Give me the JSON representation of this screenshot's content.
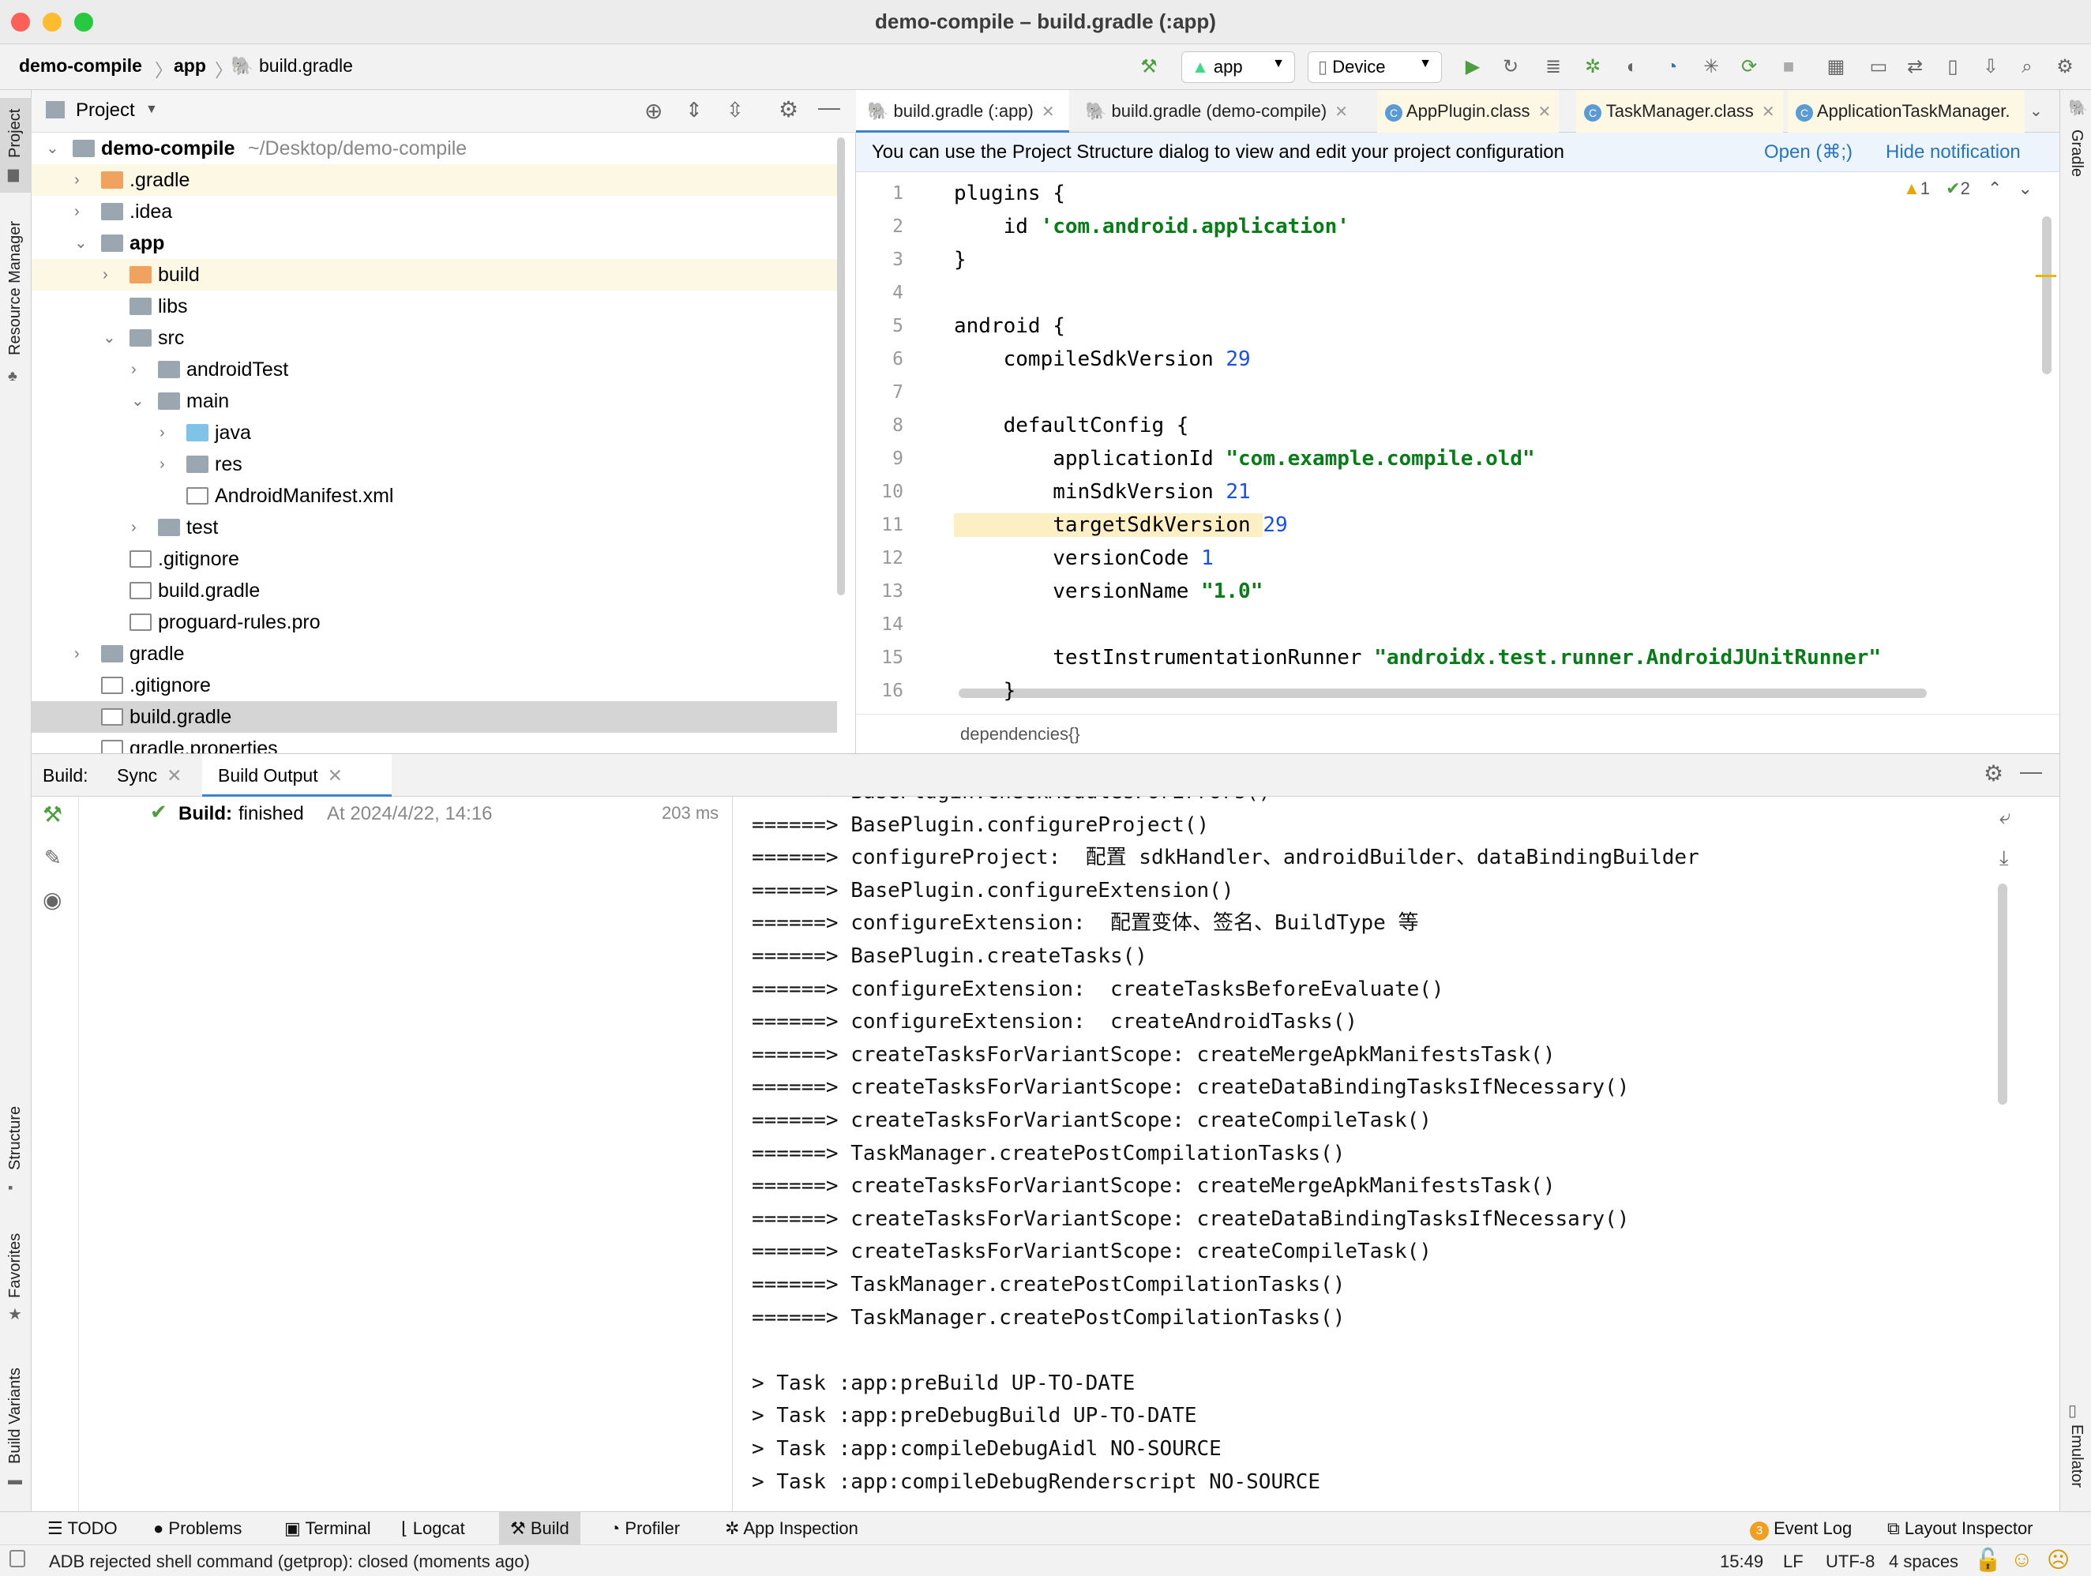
{
  "window": {
    "title": "demo-compile – build.gradle (:app)"
  },
  "breadcrumb": {
    "project": "demo-compile",
    "module": "app",
    "file": "build.gradle"
  },
  "toolbar": {
    "config": "app",
    "device": "Device"
  },
  "left_strip": {
    "project": "Project",
    "resource_manager": "Resource Manager",
    "structure": "Structure",
    "favorites": "Favorites",
    "build_variants": "Build Variants"
  },
  "right_strip": {
    "gradle": "Gradle",
    "emulator": "Emulator"
  },
  "project_panel": {
    "title": "Project",
    "tree": [
      {
        "name": "demo-compile",
        "path": "~/Desktop/demo-compile"
      },
      {
        "name": ".gradle"
      },
      {
        "name": ".idea"
      },
      {
        "name": "app"
      },
      {
        "name": "build"
      },
      {
        "name": "libs"
      },
      {
        "name": "src"
      },
      {
        "name": "androidTest"
      },
      {
        "name": "main"
      },
      {
        "name": "java"
      },
      {
        "name": "res"
      },
      {
        "name": "AndroidManifest.xml"
      },
      {
        "name": "test"
      },
      {
        "name": ".gitignore"
      },
      {
        "name": "build.gradle"
      },
      {
        "name": "proguard-rules.pro"
      },
      {
        "name": "gradle"
      },
      {
        "name": ".gitignore"
      },
      {
        "name": "build.gradle"
      },
      {
        "name": "gradle.properties"
      }
    ]
  },
  "editor": {
    "tabs": [
      "build.gradle (:app)",
      "build.gradle (demo-compile)",
      "AppPlugin.class",
      "TaskManager.class",
      "ApplicationTaskManager."
    ],
    "notification": {
      "text": "You can use the Project Structure dialog to view and edit your project configuration",
      "open": "Open (⌘;)",
      "hide": "Hide notification"
    },
    "inspections": {
      "warnings": "1",
      "checks": "2"
    },
    "lines": [
      {
        "n": "1",
        "text": "plugins {"
      },
      {
        "n": "2",
        "a": "    id ",
        "b": "'com.android.application'"
      },
      {
        "n": "3",
        "text": "}"
      },
      {
        "n": "4",
        "text": ""
      },
      {
        "n": "5",
        "text": "android {"
      },
      {
        "n": "6",
        "a": "    compileSdkVersion ",
        "c": "29"
      },
      {
        "n": "7",
        "text": ""
      },
      {
        "n": "8",
        "text": "    defaultConfig {"
      },
      {
        "n": "9",
        "a": "        applicationId ",
        "b": "\"com.example.compile.old\""
      },
      {
        "n": "10",
        "a": "        minSdkVersion ",
        "c": "21"
      },
      {
        "n": "11",
        "a": "        targetSdkVersion ",
        "c": "29"
      },
      {
        "n": "12",
        "a": "        versionCode ",
        "c": "1"
      },
      {
        "n": "13",
        "a": "        versionName ",
        "b": "\"1.0\""
      },
      {
        "n": "14",
        "text": ""
      },
      {
        "n": "15",
        "a": "        testInstrumentationRunner ",
        "b": "\"androidx.test.runner.AndroidJUnitRunner\""
      },
      {
        "n": "16",
        "text": "    }"
      }
    ],
    "crumb": "dependencies{}"
  },
  "build": {
    "label": "Build:",
    "tabs": [
      "Sync",
      "Build Output"
    ],
    "status": {
      "bold": "Build:",
      "text": "finished",
      "time": "At 2024/4/22, 14:16",
      "duration": "203 ms"
    },
    "output": [
      "======> BasePlugin.checkModulesForErrors()",
      "======> BasePlugin.configureProject()",
      "======> configureProject:  配置 sdkHandler、androidBuilder、dataBindingBuilder",
      "======> BasePlugin.configureExtension()",
      "======> configureExtension:  配置变体、签名、BuildType 等",
      "======> BasePlugin.createTasks()",
      "======> configureExtension:  createTasksBeforeEvaluate()",
      "======> configureExtension:  createAndroidTasks()",
      "======> createTasksForVariantScope: createMergeApkManifestsTask()",
      "======> createTasksForVariantScope: createDataBindingTasksIfNecessary()",
      "======> createTasksForVariantScope: createCompileTask()",
      "======> TaskManager.createPostCompilationTasks()",
      "======> createTasksForVariantScope: createMergeApkManifestsTask()",
      "======> createTasksForVariantScope: createDataBindingTasksIfNecessary()",
      "======> createTasksForVariantScope: createCompileTask()",
      "======> TaskManager.createPostCompilationTasks()",
      "======> TaskManager.createPostCompilationTasks()",
      "",
      "> Task :app:preBuild UP-TO-DATE",
      "> Task :app:preDebugBuild UP-TO-DATE",
      "> Task :app:compileDebugAidl NO-SOURCE",
      "> Task :app:compileDebugRenderscript NO-SOURCE"
    ]
  },
  "bottom_tools": {
    "todo": "TODO",
    "problems": "Problems",
    "terminal": "Terminal",
    "logcat": "Logcat",
    "build": "Build",
    "profiler": "Profiler",
    "app_inspection": "App Inspection",
    "event_log": "Event Log",
    "event_count": "3",
    "layout_inspector": "Layout Inspector"
  },
  "status": {
    "message": "ADB rejected shell command (getprop): closed (moments ago)",
    "time": "15:49",
    "line_sep": "LF",
    "encoding": "UTF-8",
    "indent": "4 spaces"
  },
  "colors": {
    "accent": "#2675bf",
    "string": "#067d17",
    "number": "#1750eb",
    "selection": "#d5d5d5",
    "highlight": "#fdf8e3"
  }
}
